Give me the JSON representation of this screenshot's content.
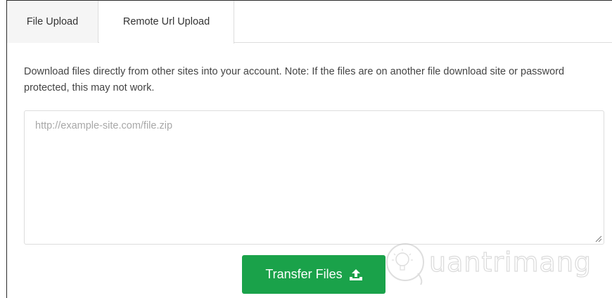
{
  "tabs": [
    {
      "label": "File Upload",
      "active": false
    },
    {
      "label": "Remote Url Upload",
      "active": true
    }
  ],
  "description": "Download files directly from other sites into your account. Note: If the files are on another file download site or password protected, this may not work.",
  "url_input": {
    "value": "",
    "placeholder": "http://example-site.com/file.zip"
  },
  "transfer_button": {
    "label": "Transfer Files",
    "icon": "upload-icon",
    "color": "#1aa24a"
  },
  "watermark": {
    "text": "uantrimang",
    "icon": "lightbulb-icon"
  }
}
